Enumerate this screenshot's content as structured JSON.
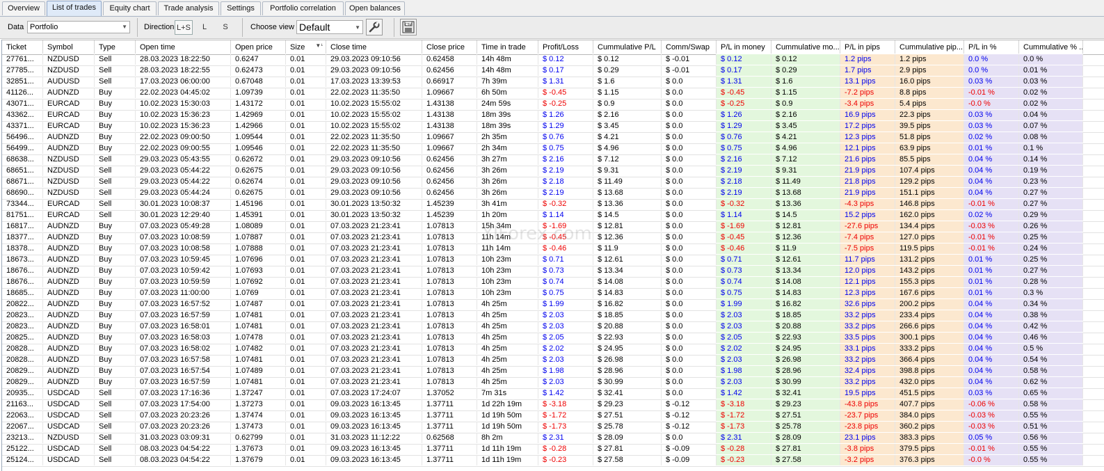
{
  "tabs": [
    {
      "label": "Overview",
      "active": false
    },
    {
      "label": "List of trades",
      "active": true
    },
    {
      "label": "Equity chart",
      "active": false
    },
    {
      "label": "Trade analysis",
      "active": false
    },
    {
      "label": "Settings",
      "active": false
    },
    {
      "label": "Portfolio correlation",
      "active": false
    },
    {
      "label": "Open balances",
      "active": false
    }
  ],
  "toolbar": {
    "data_label": "Data",
    "data_value": "Portfolio",
    "direction_label": "Direction",
    "direction_options": [
      "L+S",
      "L",
      "S"
    ],
    "direction_selected": "L+S",
    "choose_view_label": "Choose view",
    "view_value": "Default",
    "settings_icon": "wrench-icon",
    "export_icon": "csv-export-icon"
  },
  "watermark": "YlForex.com",
  "table": {
    "columns": [
      "Ticket",
      "Symbol",
      "Type",
      "Open time",
      "Open price",
      "Size",
      "Close time",
      "Close price",
      "Time in trade",
      "Profit/Loss",
      "Cummulative P/L",
      "Comm/Swap",
      "P/L in money",
      "Cummulative mo...",
      "P/L in pips",
      "Cummulative pip...",
      "P/L in %",
      "Cummulative % ..."
    ],
    "sort_indicator": "▼¹",
    "rows": [
      [
        "27761...",
        "NZDUSD",
        "Sell",
        "28.03.2023 18:22:50",
        "0.6247",
        "0.01",
        "29.03.2023 09:10:56",
        "0.62458",
        "14h 48m",
        "$ 0.12",
        "$ 0.12",
        "$ -0.01",
        "$ 0.12",
        "$ 0.12",
        "1.2 pips",
        "1.2 pips",
        "0.0 %",
        "0.0 %"
      ],
      [
        "27785...",
        "NZDUSD",
        "Sell",
        "28.03.2023 18:22:55",
        "0.62473",
        "0.01",
        "29.03.2023 09:10:56",
        "0.62456",
        "14h 48m",
        "$ 0.17",
        "$ 0.29",
        "$ -0.01",
        "$ 0.17",
        "$ 0.29",
        "1.7 pips",
        "2.9 pips",
        "0.0 %",
        "0.01 %"
      ],
      [
        "32851...",
        "AUDUSD",
        "Sell",
        "17.03.2023 06:00:00",
        "0.67048",
        "0.01",
        "17.03.2023 13:39:53",
        "0.66917",
        "7h 39m",
        "$ 1.31",
        "$ 1.6",
        "$ 0.0",
        "$ 1.31",
        "$ 1.6",
        "13.1 pips",
        "16.0 pips",
        "0.03 %",
        "0.03 %"
      ],
      [
        "41126...",
        "AUDNZD",
        "Buy",
        "22.02.2023 04:45:02",
        "1.09739",
        "0.01",
        "22.02.2023 11:35:50",
        "1.09667",
        "6h 50m",
        "$ -0.45",
        "$ 1.15",
        "$ 0.0",
        "$ -0.45",
        "$ 1.15",
        "-7.2 pips",
        "8.8 pips",
        "-0.01 %",
        "0.02 %"
      ],
      [
        "43071...",
        "EURCAD",
        "Buy",
        "10.02.2023 15:30:03",
        "1.43172",
        "0.01",
        "10.02.2023 15:55:02",
        "1.43138",
        "24m 59s",
        "$ -0.25",
        "$ 0.9",
        "$ 0.0",
        "$ -0.25",
        "$ 0.9",
        "-3.4 pips",
        "5.4 pips",
        "-0.0 %",
        "0.02 %"
      ],
      [
        "43362...",
        "EURCAD",
        "Buy",
        "10.02.2023 15:36:23",
        "1.42969",
        "0.01",
        "10.02.2023 15:55:02",
        "1.43138",
        "18m 39s",
        "$ 1.26",
        "$ 2.16",
        "$ 0.0",
        "$ 1.26",
        "$ 2.16",
        "16.9 pips",
        "22.3 pips",
        "0.03 %",
        "0.04 %"
      ],
      [
        "43371...",
        "EURCAD",
        "Buy",
        "10.02.2023 15:36:23",
        "1.42966",
        "0.01",
        "10.02.2023 15:55:02",
        "1.43138",
        "18m 39s",
        "$ 1.29",
        "$ 3.45",
        "$ 0.0",
        "$ 1.29",
        "$ 3.45",
        "17.2 pips",
        "39.5 pips",
        "0.03 %",
        "0.07 %"
      ],
      [
        "56496...",
        "AUDNZD",
        "Buy",
        "22.02.2023 09:00:50",
        "1.09544",
        "0.01",
        "22.02.2023 11:35:50",
        "1.09667",
        "2h 35m",
        "$ 0.76",
        "$ 4.21",
        "$ 0.0",
        "$ 0.76",
        "$ 4.21",
        "12.3 pips",
        "51.8 pips",
        "0.02 %",
        "0.08 %"
      ],
      [
        "56499...",
        "AUDNZD",
        "Buy",
        "22.02.2023 09:00:55",
        "1.09546",
        "0.01",
        "22.02.2023 11:35:50",
        "1.09667",
        "2h 34m",
        "$ 0.75",
        "$ 4.96",
        "$ 0.0",
        "$ 0.75",
        "$ 4.96",
        "12.1 pips",
        "63.9 pips",
        "0.01 %",
        "0.1 %"
      ],
      [
        "68638...",
        "NZDUSD",
        "Sell",
        "29.03.2023 05:43:55",
        "0.62672",
        "0.01",
        "29.03.2023 09:10:56",
        "0.62456",
        "3h 27m",
        "$ 2.16",
        "$ 7.12",
        "$ 0.0",
        "$ 2.16",
        "$ 7.12",
        "21.6 pips",
        "85.5 pips",
        "0.04 %",
        "0.14 %"
      ],
      [
        "68651...",
        "NZDUSD",
        "Sell",
        "29.03.2023 05:44:22",
        "0.62675",
        "0.01",
        "29.03.2023 09:10:56",
        "0.62456",
        "3h 26m",
        "$ 2.19",
        "$ 9.31",
        "$ 0.0",
        "$ 2.19",
        "$ 9.31",
        "21.9 pips",
        "107.4 pips",
        "0.04 %",
        "0.19 %"
      ],
      [
        "68671...",
        "NZDUSD",
        "Sell",
        "29.03.2023 05:44:22",
        "0.62674",
        "0.01",
        "29.03.2023 09:10:56",
        "0.62456",
        "3h 26m",
        "$ 2.18",
        "$ 11.49",
        "$ 0.0",
        "$ 2.18",
        "$ 11.49",
        "21.8 pips",
        "129.2 pips",
        "0.04 %",
        "0.23 %"
      ],
      [
        "68690...",
        "NZDUSD",
        "Sell",
        "29.03.2023 05:44:24",
        "0.62675",
        "0.01",
        "29.03.2023 09:10:56",
        "0.62456",
        "3h 26m",
        "$ 2.19",
        "$ 13.68",
        "$ 0.0",
        "$ 2.19",
        "$ 13.68",
        "21.9 pips",
        "151.1 pips",
        "0.04 %",
        "0.27 %"
      ],
      [
        "73344...",
        "EURCAD",
        "Sell",
        "30.01.2023 10:08:37",
        "1.45196",
        "0.01",
        "30.01.2023 13:50:32",
        "1.45239",
        "3h 41m",
        "$ -0.32",
        "$ 13.36",
        "$ 0.0",
        "$ -0.32",
        "$ 13.36",
        "-4.3 pips",
        "146.8 pips",
        "-0.01 %",
        "0.27 %"
      ],
      [
        "81751...",
        "EURCAD",
        "Sell",
        "30.01.2023 12:29:40",
        "1.45391",
        "0.01",
        "30.01.2023 13:50:32",
        "1.45239",
        "1h 20m",
        "$ 1.14",
        "$ 14.5",
        "$ 0.0",
        "$ 1.14",
        "$ 14.5",
        "15.2 pips",
        "162.0 pips",
        "0.02 %",
        "0.29 %"
      ],
      [
        "16817...",
        "AUDNZD",
        "Buy",
        "07.03.2023 05:49:28",
        "1.08089",
        "0.01",
        "07.03.2023 21:23:41",
        "1.07813",
        "15h 34m",
        "$ -1.69",
        "$ 12.81",
        "$ 0.0",
        "$ -1.69",
        "$ 12.81",
        "-27.6 pips",
        "134.4 pips",
        "-0.03 %",
        "0.26 %"
      ],
      [
        "18377...",
        "AUDNZD",
        "Buy",
        "07.03.2023 10:08:59",
        "1.07887",
        "0.01",
        "07.03.2023 21:23:41",
        "1.07813",
        "11h 14m",
        "$ -0.45",
        "$ 12.36",
        "$ 0.0",
        "$ -0.45",
        "$ 12.36",
        "-7.4 pips",
        "127.0 pips",
        "-0.01 %",
        "0.25 %"
      ],
      [
        "18378...",
        "AUDNZD",
        "Buy",
        "07.03.2023 10:08:58",
        "1.07888",
        "0.01",
        "07.03.2023 21:23:41",
        "1.07813",
        "11h 14m",
        "$ -0.46",
        "$ 11.9",
        "$ 0.0",
        "$ -0.46",
        "$ 11.9",
        "-7.5 pips",
        "119.5 pips",
        "-0.01 %",
        "0.24 %"
      ],
      [
        "18673...",
        "AUDNZD",
        "Buy",
        "07.03.2023 10:59:45",
        "1.07696",
        "0.01",
        "07.03.2023 21:23:41",
        "1.07813",
        "10h 23m",
        "$ 0.71",
        "$ 12.61",
        "$ 0.0",
        "$ 0.71",
        "$ 12.61",
        "11.7 pips",
        "131.2 pips",
        "0.01 %",
        "0.25 %"
      ],
      [
        "18676...",
        "AUDNZD",
        "Buy",
        "07.03.2023 10:59:42",
        "1.07693",
        "0.01",
        "07.03.2023 21:23:41",
        "1.07813",
        "10h 23m",
        "$ 0.73",
        "$ 13.34",
        "$ 0.0",
        "$ 0.73",
        "$ 13.34",
        "12.0 pips",
        "143.2 pips",
        "0.01 %",
        "0.27 %"
      ],
      [
        "18676...",
        "AUDNZD",
        "Buy",
        "07.03.2023 10:59:59",
        "1.07692",
        "0.01",
        "07.03.2023 21:23:41",
        "1.07813",
        "10h 23m",
        "$ 0.74",
        "$ 14.08",
        "$ 0.0",
        "$ 0.74",
        "$ 14.08",
        "12.1 pips",
        "155.3 pips",
        "0.01 %",
        "0.28 %"
      ],
      [
        "18685...",
        "AUDNZD",
        "Buy",
        "07.03.2023 11:00:00",
        "1.0769",
        "0.01",
        "07.03.2023 21:23:41",
        "1.07813",
        "10h 23m",
        "$ 0.75",
        "$ 14.83",
        "$ 0.0",
        "$ 0.75",
        "$ 14.83",
        "12.3 pips",
        "167.6 pips",
        "0.01 %",
        "0.3 %"
      ],
      [
        "20822...",
        "AUDNZD",
        "Buy",
        "07.03.2023 16:57:52",
        "1.07487",
        "0.01",
        "07.03.2023 21:23:41",
        "1.07813",
        "4h 25m",
        "$ 1.99",
        "$ 16.82",
        "$ 0.0",
        "$ 1.99",
        "$ 16.82",
        "32.6 pips",
        "200.2 pips",
        "0.04 %",
        "0.34 %"
      ],
      [
        "20823...",
        "AUDNZD",
        "Buy",
        "07.03.2023 16:57:59",
        "1.07481",
        "0.01",
        "07.03.2023 21:23:41",
        "1.07813",
        "4h 25m",
        "$ 2.03",
        "$ 18.85",
        "$ 0.0",
        "$ 2.03",
        "$ 18.85",
        "33.2 pips",
        "233.4 pips",
        "0.04 %",
        "0.38 %"
      ],
      [
        "20823...",
        "AUDNZD",
        "Buy",
        "07.03.2023 16:58:01",
        "1.07481",
        "0.01",
        "07.03.2023 21:23:41",
        "1.07813",
        "4h 25m",
        "$ 2.03",
        "$ 20.88",
        "$ 0.0",
        "$ 2.03",
        "$ 20.88",
        "33.2 pips",
        "266.6 pips",
        "0.04 %",
        "0.42 %"
      ],
      [
        "20825...",
        "AUDNZD",
        "Buy",
        "07.03.2023 16:58:03",
        "1.07478",
        "0.01",
        "07.03.2023 21:23:41",
        "1.07813",
        "4h 25m",
        "$ 2.05",
        "$ 22.93",
        "$ 0.0",
        "$ 2.05",
        "$ 22.93",
        "33.5 pips",
        "300.1 pips",
        "0.04 %",
        "0.46 %"
      ],
      [
        "20828...",
        "AUDNZD",
        "Buy",
        "07.03.2023 16:58:02",
        "1.07482",
        "0.01",
        "07.03.2023 21:23:41",
        "1.07813",
        "4h 25m",
        "$ 2.02",
        "$ 24.95",
        "$ 0.0",
        "$ 2.02",
        "$ 24.95",
        "33.1 pips",
        "333.2 pips",
        "0.04 %",
        "0.5 %"
      ],
      [
        "20828...",
        "AUDNZD",
        "Buy",
        "07.03.2023 16:57:58",
        "1.07481",
        "0.01",
        "07.03.2023 21:23:41",
        "1.07813",
        "4h 25m",
        "$ 2.03",
        "$ 26.98",
        "$ 0.0",
        "$ 2.03",
        "$ 26.98",
        "33.2 pips",
        "366.4 pips",
        "0.04 %",
        "0.54 %"
      ],
      [
        "20829...",
        "AUDNZD",
        "Buy",
        "07.03.2023 16:57:54",
        "1.07489",
        "0.01",
        "07.03.2023 21:23:41",
        "1.07813",
        "4h 25m",
        "$ 1.98",
        "$ 28.96",
        "$ 0.0",
        "$ 1.98",
        "$ 28.96",
        "32.4 pips",
        "398.8 pips",
        "0.04 %",
        "0.58 %"
      ],
      [
        "20829...",
        "AUDNZD",
        "Buy",
        "07.03.2023 16:57:59",
        "1.07481",
        "0.01",
        "07.03.2023 21:23:41",
        "1.07813",
        "4h 25m",
        "$ 2.03",
        "$ 30.99",
        "$ 0.0",
        "$ 2.03",
        "$ 30.99",
        "33.2 pips",
        "432.0 pips",
        "0.04 %",
        "0.62 %"
      ],
      [
        "20935...",
        "USDCAD",
        "Sell",
        "07.03.2023 17:16:36",
        "1.37247",
        "0.01",
        "07.03.2023 17:24:07",
        "1.37052",
        "7m 31s",
        "$ 1.42",
        "$ 32.41",
        "$ 0.0",
        "$ 1.42",
        "$ 32.41",
        "19.5 pips",
        "451.5 pips",
        "0.03 %",
        "0.65 %"
      ],
      [
        "21163...",
        "USDCAD",
        "Sell",
        "07.03.2023 17:54:00",
        "1.37273",
        "0.01",
        "09.03.2023 16:13:45",
        "1.37711",
        "1d 22h 19m",
        "$ -3.18",
        "$ 29.23",
        "$ -0.12",
        "$ -3.18",
        "$ 29.23",
        "-43.8 pips",
        "407.7 pips",
        "-0.06 %",
        "0.58 %"
      ],
      [
        "22063...",
        "USDCAD",
        "Sell",
        "07.03.2023 20:23:26",
        "1.37474",
        "0.01",
        "09.03.2023 16:13:45",
        "1.37711",
        "1d 19h 50m",
        "$ -1.72",
        "$ 27.51",
        "$ -0.12",
        "$ -1.72",
        "$ 27.51",
        "-23.7 pips",
        "384.0 pips",
        "-0.03 %",
        "0.55 %"
      ],
      [
        "22067...",
        "USDCAD",
        "Sell",
        "07.03.2023 20:23:26",
        "1.37473",
        "0.01",
        "09.03.2023 16:13:45",
        "1.37711",
        "1d 19h 50m",
        "$ -1.73",
        "$ 25.78",
        "$ -0.12",
        "$ -1.73",
        "$ 25.78",
        "-23.8 pips",
        "360.2 pips",
        "-0.03 %",
        "0.51 %"
      ],
      [
        "23213...",
        "NZDUSD",
        "Sell",
        "31.03.2023 03:09:31",
        "0.62799",
        "0.01",
        "31.03.2023 11:12:22",
        "0.62568",
        "8h 2m",
        "$ 2.31",
        "$ 28.09",
        "$ 0.0",
        "$ 2.31",
        "$ 28.09",
        "23.1 pips",
        "383.3 pips",
        "0.05 %",
        "0.56 %"
      ],
      [
        "25122...",
        "USDCAD",
        "Sell",
        "08.03.2023 04:54:22",
        "1.37673",
        "0.01",
        "09.03.2023 16:13:45",
        "1.37711",
        "1d 11h 19m",
        "$ -0.28",
        "$ 27.81",
        "$ -0.09",
        "$ -0.28",
        "$ 27.81",
        "-3.8 pips",
        "379.5 pips",
        "-0.01 %",
        "0.55 %"
      ],
      [
        "25124...",
        "USDCAD",
        "Sell",
        "08.03.2023 04:54:22",
        "1.37679",
        "0.01",
        "09.03.2023 16:13:45",
        "1.37711",
        "1d 11h 19m",
        "$ -0.23",
        "$ 27.58",
        "$ -0.09",
        "$ -0.23",
        "$ 27.58",
        "-3.2 pips",
        "376.3 pips",
        "-0.0 %",
        "0.55 %"
      ]
    ]
  }
}
